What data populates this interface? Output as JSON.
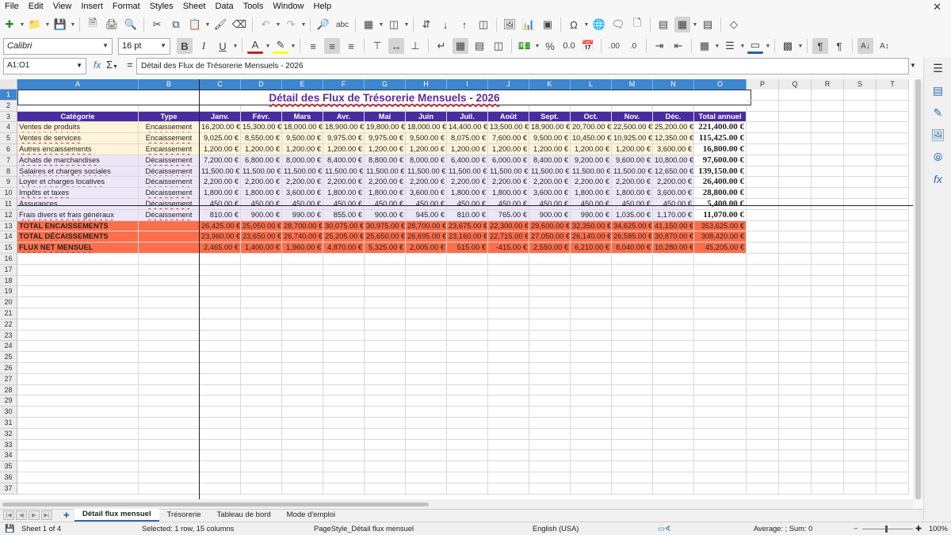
{
  "menu": [
    "File",
    "Edit",
    "View",
    "Insert",
    "Format",
    "Styles",
    "Sheet",
    "Data",
    "Tools",
    "Window",
    "Help"
  ],
  "font": {
    "name": "Calibri",
    "size": "16 pt"
  },
  "formula_bar": {
    "name_box": "A1:O1",
    "content": "Détail des Flux de Trésorerie Mensuels - 2026"
  },
  "columns": [
    "A",
    "B",
    "C",
    "D",
    "E",
    "F",
    "G",
    "H",
    "I",
    "J",
    "K",
    "L",
    "M",
    "N",
    "O",
    "P",
    "Q",
    "R",
    "S",
    "T"
  ],
  "rows": [
    "1",
    "2",
    "3",
    "4",
    "5",
    "6",
    "7",
    "8",
    "9",
    "10",
    "11",
    "12",
    "13",
    "14",
    "15",
    "16",
    "17",
    "18",
    "19",
    "20",
    "21",
    "22",
    "23",
    "24",
    "25",
    "26",
    "27",
    "28",
    "29",
    "30",
    "31",
    "32",
    "33",
    "34",
    "35",
    "36",
    "37"
  ],
  "sheet": {
    "title": "Détail des Flux de Trésorerie Mensuels - 2026",
    "headers": [
      "Catégorie",
      "Type",
      "Janv.",
      "Févr.",
      "Mars",
      "Avr.",
      "Mai",
      "Juin",
      "Juil.",
      "Août",
      "Sept.",
      "Oct.",
      "Nov.",
      "Déc.",
      "Total annuel"
    ],
    "data_rows": [
      [
        "Ventes de produits",
        "Encaissement",
        "16,200.00 €",
        "15,300.00 €",
        "18,000.00 €",
        "18,900.00 €",
        "19,800.00 €",
        "18,000.00 €",
        "14,400.00 €",
        "13,500.00 €",
        "18,900.00 €",
        "20,700.00 €",
        "22,500.00 €",
        "25,200.00 €",
        "221,400.00 €"
      ],
      [
        "Ventes de services",
        "Encaissement",
        "9,025.00 €",
        "8,550.00 €",
        "9,500.00 €",
        "9,975.00 €",
        "9,975.00 €",
        "9,500.00 €",
        "8,075.00 €",
        "7,600.00 €",
        "9,500.00 €",
        "10,450.00 €",
        "10,925.00 €",
        "12,350.00 €",
        "115,425.00 €"
      ],
      [
        "Autres encaissements",
        "Encaissement",
        "1,200.00 €",
        "1,200.00 €",
        "1,200.00 €",
        "1,200.00 €",
        "1,200.00 €",
        "1,200.00 €",
        "1,200.00 €",
        "1,200.00 €",
        "1,200.00 €",
        "1,200.00 €",
        "1,200.00 €",
        "3,600.00 €",
        "16,800.00 €"
      ],
      [
        "Achats de marchandises",
        "Décaissement",
        "7,200.00 €",
        "6,800.00 €",
        "8,000.00 €",
        "8,400.00 €",
        "8,800.00 €",
        "8,000.00 €",
        "6,400.00 €",
        "6,000.00 €",
        "8,400.00 €",
        "9,200.00 €",
        "9,600.00 €",
        "10,800.00 €",
        "97,600.00 €"
      ],
      [
        "Salaires et charges sociales",
        "Décaissement",
        "11,500.00 €",
        "11,500.00 €",
        "11,500.00 €",
        "11,500.00 €",
        "11,500.00 €",
        "11,500.00 €",
        "11,500.00 €",
        "11,500.00 €",
        "11,500.00 €",
        "11,500.00 €",
        "11,500.00 €",
        "12,650.00 €",
        "139,150.00 €"
      ],
      [
        "Loyer et charges locatives",
        "Décaissement",
        "2,200.00 €",
        "2,200.00 €",
        "2,200.00 €",
        "2,200.00 €",
        "2,200.00 €",
        "2,200.00 €",
        "2,200.00 €",
        "2,200.00 €",
        "2,200.00 €",
        "2,200.00 €",
        "2,200.00 €",
        "2,200.00 €",
        "26,400.00 €"
      ],
      [
        "Impôts et taxes",
        "Décaissement",
        "1,800.00 €",
        "1,800.00 €",
        "3,600.00 €",
        "1,800.00 €",
        "1,800.00 €",
        "3,600.00 €",
        "1,800.00 €",
        "1,800.00 €",
        "3,600.00 €",
        "1,800.00 €",
        "1,800.00 €",
        "3,600.00 €",
        "28,800.00 €"
      ],
      [
        "Assurances",
        "Décaissement",
        "450.00 €",
        "450.00 €",
        "450.00 €",
        "450.00 €",
        "450.00 €",
        "450.00 €",
        "450.00 €",
        "450.00 €",
        "450.00 €",
        "450.00 €",
        "450.00 €",
        "450.00 €",
        "5,400.00 €"
      ],
      [
        "Frais divers et frais généraux",
        "Décaissement",
        "810.00 €",
        "900.00 €",
        "990.00 €",
        "855.00 €",
        "900.00 €",
        "945.00 €",
        "810.00 €",
        "765.00 €",
        "900.00 €",
        "990.00 €",
        "1,035.00 €",
        "1,170.00 €",
        "11,070.00 €"
      ]
    ],
    "total_rows": [
      [
        "TOTAL ENCAISSEMENTS",
        "",
        "26,425.00 €",
        "25,050.00 €",
        "28,700.00 €",
        "30,075.00 €",
        "30,975.00 €",
        "28,700.00 €",
        "23,675.00 €",
        "22,300.00 €",
        "29,600.00 €",
        "32,350.00 €",
        "34,625.00 €",
        "41,150.00 €",
        "353,625.00 €"
      ],
      [
        "TOTAL DÉCAISSEMENTS",
        "",
        "23,960.00 €",
        "23,650.00 €",
        "26,740.00 €",
        "25,205.00 €",
        "25,650.00 €",
        "26,695.00 €",
        "23,160.00 €",
        "22,715.00 €",
        "27,050.00 €",
        "26,140.00 €",
        "26,585.00 €",
        "30,870.00 €",
        "308,420.00 €"
      ],
      [
        "FLUX NET MENSUEL",
        "",
        "2,465.00 €",
        "1,400.00 €",
        "1,960.00 €",
        "4,870.00 €",
        "5,325.00 €",
        "2,005.00 €",
        "515.00 €",
        "-415.00 €",
        "2,550.00 €",
        "6,210.00 €",
        "8,040.00 €",
        "10,280.00 €",
        "45,205.00 €"
      ]
    ]
  },
  "tabs": [
    "Détail flux mensuel",
    "Trésorerie",
    "Tableau de bord",
    "Mode d'emploi"
  ],
  "status": {
    "sheet": "Sheet 1 of 4",
    "selection": "Selected: 1 row, 15 columns",
    "page_style": "PageStyle_Détail flux mensuel",
    "language": "English (USA)",
    "summary": "Average: ; Sum: 0",
    "zoom": "100%"
  },
  "colors": {
    "header_bg": "#4a2ba0",
    "total_bg": "#ff6e4a",
    "encaissement_bg": "#fff4d9",
    "decaissement_bg": "#ece6f8",
    "selection": "#3d86d0"
  }
}
